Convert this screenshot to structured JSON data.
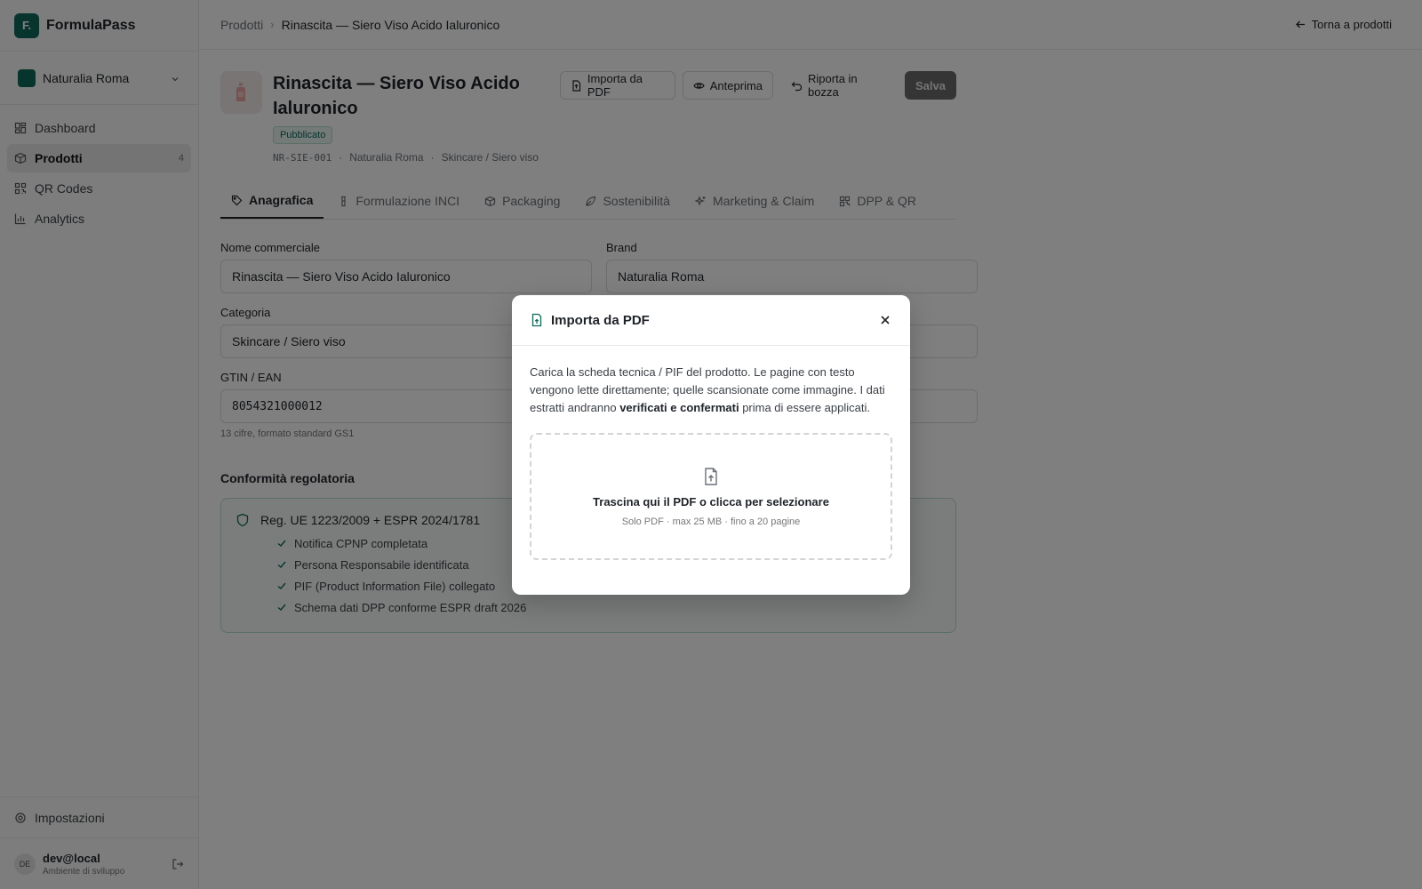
{
  "app": {
    "logo_letter": "F.",
    "name": "FormulaPass"
  },
  "org": {
    "name": "Naturalia Roma"
  },
  "nav": [
    {
      "label": "Dashboard",
      "icon": "dashboard-icon"
    },
    {
      "label": "Prodotti",
      "icon": "box-icon",
      "count": "4",
      "active": true
    },
    {
      "label": "QR Codes",
      "icon": "qr-icon"
    },
    {
      "label": "Analytics",
      "icon": "chart-icon"
    }
  ],
  "settings_label": "Impostazioni",
  "user": {
    "initials": "DE",
    "name": "dev@local",
    "env": "Ambiente di sviluppo"
  },
  "breadcrumb": {
    "parent": "Prodotti",
    "sep": "›",
    "current": "Rinascita — Siero Viso Acido Ialuronico"
  },
  "back_label": "Torna a prodotti",
  "product": {
    "title": "Rinascita — Siero Viso Acido Ialuronico",
    "status": "Pubblicato",
    "sku": "NR-SIE-001",
    "brand": "Naturalia Roma",
    "category": "Skincare / Siero viso",
    "meta_dot": "·"
  },
  "actions": {
    "import_pdf": "Importa da PDF",
    "preview": "Anteprima",
    "draft": "Riporta in bozza",
    "save": "Salva"
  },
  "tabs": [
    {
      "label": "Anagrafica",
      "icon": "tag-icon"
    },
    {
      "label": "Formulazione INCI",
      "icon": "flask-icon"
    },
    {
      "label": "Packaging",
      "icon": "package-icon"
    },
    {
      "label": "Sostenibilità",
      "icon": "leaf-icon"
    },
    {
      "label": "Marketing & Claim",
      "icon": "sparkles-icon"
    },
    {
      "label": "DPP & QR",
      "icon": "qr-icon"
    }
  ],
  "form": {
    "name_label": "Nome commerciale",
    "name_value": "Rinascita — Siero Viso Acido Ialuronico",
    "brand_label": "Brand",
    "brand_value": "Naturalia Roma",
    "category_label": "Categoria",
    "category_value": "Skincare / Siero viso",
    "gtin_label": "GTIN / EAN",
    "gtin_value": "8054321000012",
    "gtin_hint": "13 cifre, formato standard GS1"
  },
  "compliance": {
    "section_title": "Conformità regolatoria",
    "regulation": "Reg. UE 1223/2009 + ESPR 2024/1781",
    "checks": [
      "Notifica CPNP completata",
      "Persona Responsabile identificata",
      "PIF (Product Information File) collegato",
      "Schema dati DPP conforme ESPR draft 2026"
    ]
  },
  "modal": {
    "title": "Importa da PDF",
    "desc_before": "Carica la scheda tecnica / PIF del prodotto. Le pagine con testo vengono lette direttamente; quelle scansionate come immagine. I dati estratti andranno ",
    "desc_bold": "verificati e confermati",
    "desc_after": " prima di essere applicati.",
    "drop_title": "Trascina qui il PDF o clicca per selezionare",
    "drop_sub": "Solo PDF · max 25 MB · fino a 20 pagine"
  },
  "colors": {
    "accent": "#0f6b5c",
    "badge_bg": "#e6f4ef",
    "overlay": "rgba(0,0,0,0.5)"
  }
}
